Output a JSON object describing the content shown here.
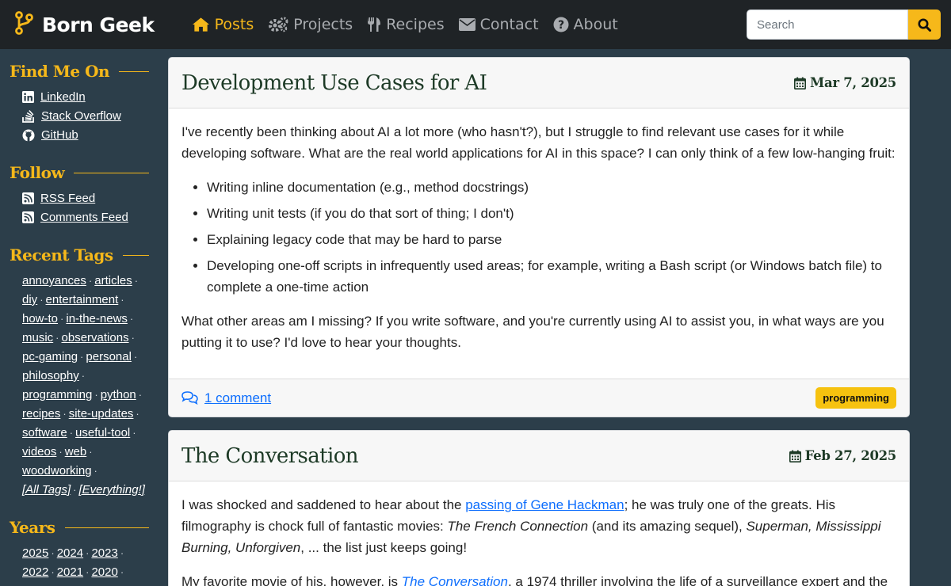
{
  "brand": {
    "name": "Born Geek",
    "logo_icon": "fork-logo-icon",
    "accent": "#f6b81a"
  },
  "nav": {
    "items": [
      {
        "label": "Posts",
        "icon": "home-icon",
        "active": true
      },
      {
        "label": "Projects",
        "icon": "gears-icon",
        "active": false
      },
      {
        "label": "Recipes",
        "icon": "utensils-icon",
        "active": false
      },
      {
        "label": "Contact",
        "icon": "envelope-icon",
        "active": false
      },
      {
        "label": "About",
        "icon": "question-circle-icon",
        "active": false
      }
    ],
    "search_placeholder": "Search"
  },
  "sidebar": {
    "find_me_heading": "Find Me On",
    "find_me": [
      {
        "label": "LinkedIn",
        "icon": "linkedin-icon"
      },
      {
        "label": "Stack Overflow",
        "icon": "stack-overflow-icon"
      },
      {
        "label": "GitHub",
        "icon": "github-icon"
      }
    ],
    "follow_heading": "Follow",
    "follow": [
      {
        "label": "RSS Feed",
        "icon": "rss-icon"
      },
      {
        "label": "Comments Feed",
        "icon": "rss-icon"
      }
    ],
    "tags_heading": "Recent Tags",
    "tags": [
      "annoyances",
      "articles",
      "diy",
      "entertainment",
      "how-to",
      "in-the-news",
      "music",
      "observations",
      "pc-gaming",
      "personal",
      "philosophy",
      "programming",
      "python",
      "recipes",
      "site-updates",
      "software",
      "useful-tool",
      "videos",
      "web",
      "woodworking"
    ],
    "all_tags": "[All Tags]",
    "everything": "[Everything!]",
    "years_heading": "Years",
    "years": [
      "2025",
      "2024",
      "2023",
      "2022",
      "2021",
      "2020"
    ]
  },
  "posts": [
    {
      "title": "Development Use Cases for AI",
      "date": "Mar 7, 2025",
      "intro": "I've recently been thinking about AI a lot more (who hasn't?), but I struggle to find relevant use cases for it while developing software. What are the real world applications for AI in this space? I can only think of a few low-hanging fruit:",
      "bullets": [
        "Writing inline documentation (e.g., method docstrings)",
        "Writing unit tests (if you do that sort of thing; I don't)",
        "Explaining legacy code that may be hard to parse",
        "Developing one-off scripts in infrequently used areas; for example, writing a Bash script (or Windows batch file) to complete a one-time action"
      ],
      "outro": "What other areas am I missing? If you write software, and you're currently using AI to assist you, in what ways are you putting it to use? I'd love to hear your thoughts.",
      "comments": "1 comment",
      "tag": "programming"
    },
    {
      "title": "The Conversation",
      "date": "Feb 27, 2025",
      "p1_a": "I was shocked and saddened to hear about the ",
      "p1_link": "passing of Gene Hackman",
      "p1_b": "; he was truly one of the greats. His filmography is chock full of fantastic movies: ",
      "p1_film1": "The French Connection",
      "p1_c": " (and its amazing sequel), ",
      "p1_film2": "Superman, Mississippi Burning, Unforgiven",
      "p1_d": ", ... the list just keeps going!",
      "p2_a": "My favorite movie of his, however, is ",
      "p2_link": "The Conversation",
      "p2_b": ", a 1974 thriller involving the life of a surveillance expert and the"
    }
  ]
}
